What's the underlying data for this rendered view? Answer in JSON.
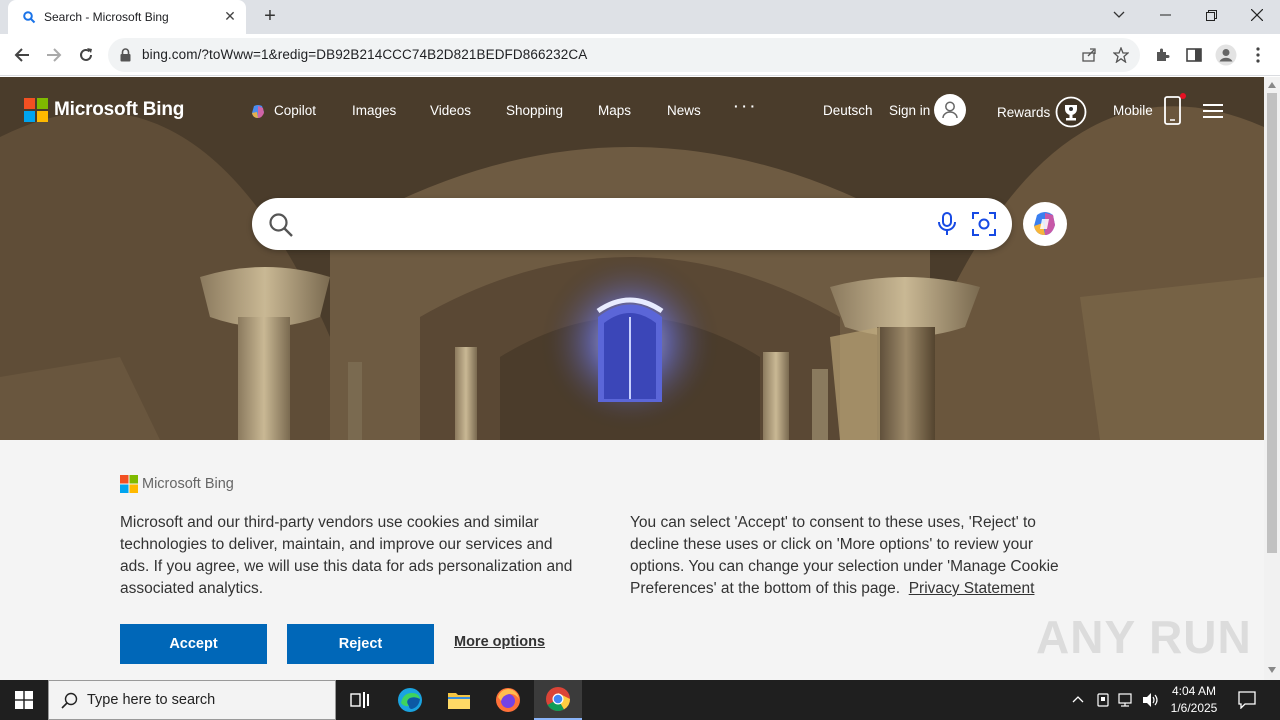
{
  "browser": {
    "tab_title": "Search - Microsoft Bing",
    "url": "bing.com/?toWww=1&redig=DB92B214CCC74B2D821BEDFD866232CA"
  },
  "header": {
    "brand": "Microsoft Bing",
    "nav": [
      "Copilot",
      "Images",
      "Videos",
      "Shopping",
      "Maps",
      "News",
      "· · ·"
    ],
    "language": "Deutsch",
    "sign_in": "Sign in",
    "rewards": "Rewards",
    "mobile": "Mobile"
  },
  "search": {
    "placeholder": ""
  },
  "cookie_banner": {
    "brand": "Microsoft Bing",
    "left_text": "Microsoft and our third-party vendors use cookies and similar technologies to deliver, maintain, and improve our services and ads. If you agree, we will use this data for ads personalization and associated analytics.",
    "right_text": "You can select 'Accept' to consent to these uses, 'Reject' to decline these uses or click on 'More options' to review your options. You can change your selection under 'Manage Cookie Preferences' at the bottom of this page.",
    "privacy_link": "Privacy Statement",
    "accept": "Accept",
    "reject": "Reject",
    "more_options": "More options"
  },
  "watermark": "ANY RUN",
  "taskbar": {
    "search_placeholder": "Type here to search",
    "time": "4:04 AM",
    "date": "1/6/2025"
  },
  "colors": {
    "accent": "#0067b8",
    "tabbar": "#dee1e6",
    "taskbar": "#1f1f1f"
  }
}
